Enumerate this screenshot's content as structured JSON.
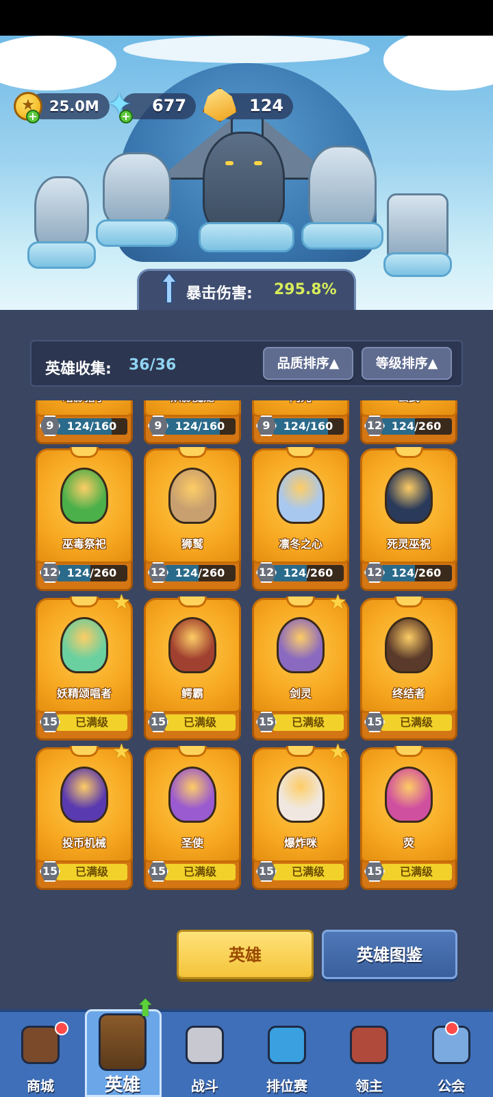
{
  "resources": {
    "gold": "25.0M",
    "crystals": "677",
    "gems": "124"
  },
  "banner": {
    "crit_label": "暴击伤害:",
    "crit_value": "295.8%"
  },
  "collection": {
    "label": "英雄收集:",
    "value": "36/36",
    "sort_quality": "品质排序▲",
    "sort_level": "等级排序▲"
  },
  "heroes": [
    {
      "name": "暗影猎手",
      "level": "9",
      "progress": "124/160",
      "fraction": 0.775,
      "maxed": false,
      "star": false,
      "color": "#4a3a6a"
    },
    {
      "name": "炽影魔龙",
      "level": "9",
      "progress": "124/160",
      "fraction": 0.775,
      "maxed": false,
      "star": false,
      "color": "#8a2a2a"
    },
    {
      "name": "闪光",
      "level": "9",
      "progress": "124/160",
      "fraction": 0.775,
      "maxed": false,
      "star": false,
      "color": "#f0e070"
    },
    {
      "name": "玄武",
      "level": "12",
      "progress": "124/260",
      "fraction": 0.477,
      "maxed": false,
      "star": false,
      "color": "#3a6a4a"
    },
    {
      "name": "巫毒祭祀",
      "level": "12",
      "progress": "124/260",
      "fraction": 0.477,
      "maxed": false,
      "star": false,
      "color": "#4bb04a"
    },
    {
      "name": "狮鹫",
      "level": "12",
      "progress": "124/260",
      "fraction": 0.477,
      "maxed": false,
      "star": false,
      "color": "#c8a070"
    },
    {
      "name": "凛冬之心",
      "level": "12",
      "progress": "124/260",
      "fraction": 0.477,
      "maxed": false,
      "star": false,
      "color": "#a8c8f0"
    },
    {
      "name": "死灵巫祝",
      "level": "12",
      "progress": "124/260",
      "fraction": 0.477,
      "maxed": false,
      "star": false,
      "color": "#2a3a5a"
    },
    {
      "name": "妖精颂唱者",
      "level": "15",
      "progress": "已满级",
      "fraction": 1,
      "maxed": true,
      "star": true,
      "color": "#6ad0a0"
    },
    {
      "name": "鳄霸",
      "level": "15",
      "progress": "已满级",
      "fraction": 1,
      "maxed": true,
      "star": false,
      "color": "#a04030"
    },
    {
      "name": "剑灵",
      "level": "15",
      "progress": "已满级",
      "fraction": 1,
      "maxed": true,
      "star": true,
      "color": "#8a6ac0"
    },
    {
      "name": "终结者",
      "level": "15",
      "progress": "已满级",
      "fraction": 1,
      "maxed": true,
      "star": false,
      "color": "#5a3a2a"
    },
    {
      "name": "投币机械",
      "level": "15",
      "progress": "已满级",
      "fraction": 1,
      "maxed": true,
      "star": true,
      "color": "#5a3ab0"
    },
    {
      "name": "圣使",
      "level": "15",
      "progress": "已满级",
      "fraction": 1,
      "maxed": true,
      "star": false,
      "color": "#9a5ad0"
    },
    {
      "name": "爆炸咪",
      "level": "15",
      "progress": "已满级",
      "fraction": 1,
      "maxed": true,
      "star": true,
      "color": "#f0e8e0"
    },
    {
      "name": "荧",
      "level": "15",
      "progress": "已满级",
      "fraction": 1,
      "maxed": true,
      "star": false,
      "color": "#d050a0"
    }
  ],
  "tabs": {
    "heroes": "英雄",
    "codex": "英雄图鉴"
  },
  "nav": [
    {
      "label": "商城",
      "icon": "shop-chest-icon"
    },
    {
      "label": "英雄",
      "icon": "hero-card-icon"
    },
    {
      "label": "战斗",
      "icon": "battle-swords-icon"
    },
    {
      "label": "排位赛",
      "icon": "ranked-shield-icon"
    },
    {
      "label": "领主",
      "icon": "lord-banner-icon"
    },
    {
      "label": "公会",
      "icon": "guild-castle-icon"
    }
  ]
}
